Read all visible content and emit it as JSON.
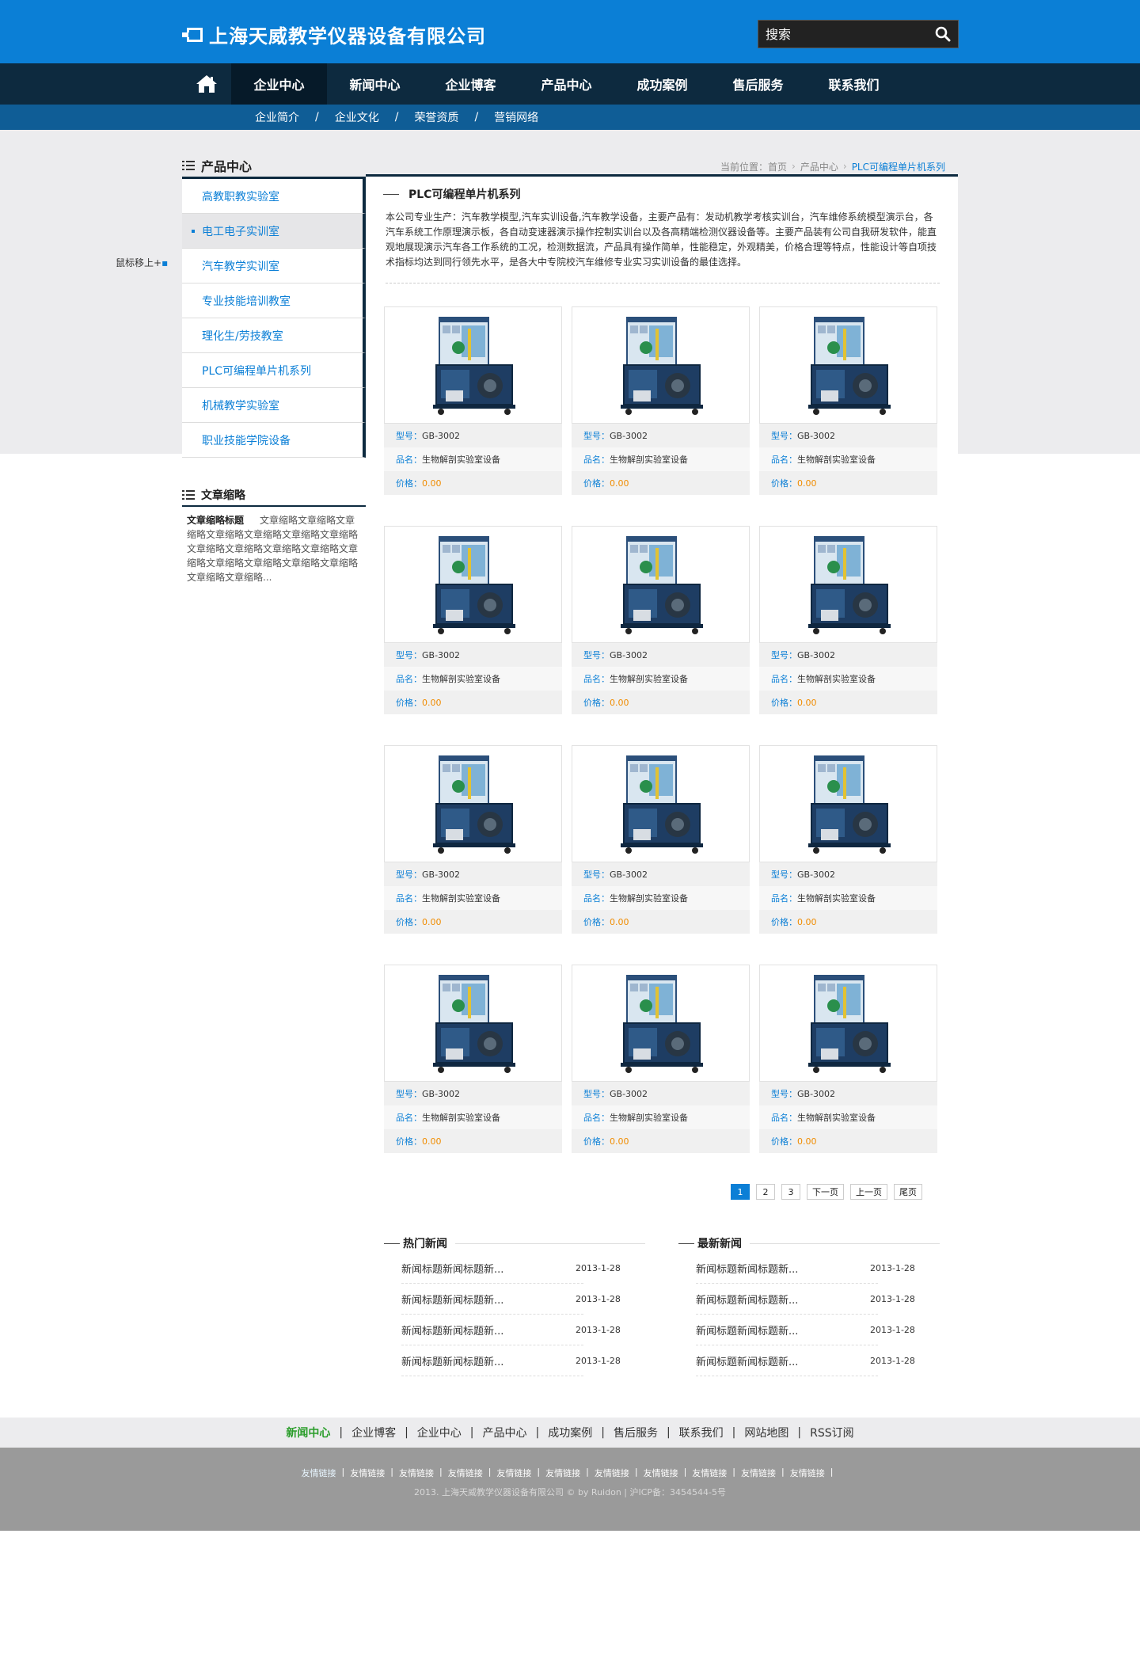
{
  "header": {
    "company_name": "上海天威教学仪器设备有限公司",
    "search_placeholder": "搜索"
  },
  "nav": {
    "items": [
      "企业中心",
      "新闻中心",
      "企业博客",
      "产品中心",
      "成功案例",
      "售后服务",
      "联系我们"
    ],
    "active": 0
  },
  "subnav": {
    "items": [
      "企业简介",
      "企业文化",
      "荣誉资质",
      "营销网络"
    ],
    "separator": "/"
  },
  "sidebar": {
    "title": "产品中心",
    "items": [
      "高教职教实验室",
      "电工电子实训室",
      "汽车教学实训室",
      "专业技能培训教室",
      "理化生/劳技教室",
      "PLC可编程单片机系列",
      "机械教学实验室",
      "职业技能学院设备"
    ],
    "active": 1,
    "hover_tip": "鼠标移上+"
  },
  "summary": {
    "title": "文章缩略",
    "heading": "文章缩略标题",
    "text": "文章缩略文章缩略文章缩略文章缩略文章缩略文章缩略文章缩略文章缩略文章缩略文章缩略文章缩略文章缩略文章缩略文章缩略文章缩略文章缩略文章缩略文章缩略..."
  },
  "breadcrumb": {
    "label": "当前位置：",
    "items": [
      "首页",
      "产品中心",
      "PLC可编程单片机系列"
    ]
  },
  "main": {
    "title": "PLC可编程单片机系列",
    "description": "本公司专业生产：汽车教学模型,汽车实训设备,汽车教学设备，主要产品有：发动机教学考核实训台，汽车维修系统模型演示台，各汽车系统工作原理演示板，各自动变速器演示操作控制实训台以及各高精端检测仪器设备等。主要产品装有公司自我研发软件，能直观地展现演示汽车各工作系统的工况，检测数据流，产品具有操作简单，性能稳定，外观精美，价格合理等特点，性能设计等自项技术指标均达到同行领先水平，是各大中专院校汽车维修专业实习实训设备的最佳选择。"
  },
  "products": {
    "labels": {
      "model": "型号：",
      "name": "品名：",
      "price": "价格："
    },
    "items": [
      {
        "model": "GB-3002",
        "name": "生物解剖实验室设备",
        "price": "0.00"
      },
      {
        "model": "GB-3002",
        "name": "生物解剖实验室设备",
        "price": "0.00"
      },
      {
        "model": "GB-3002",
        "name": "生物解剖实验室设备",
        "price": "0.00"
      },
      {
        "model": "GB-3002",
        "name": "生物解剖实验室设备",
        "price": "0.00"
      },
      {
        "model": "GB-3002",
        "name": "生物解剖实验室设备",
        "price": "0.00"
      },
      {
        "model": "GB-3002",
        "name": "生物解剖实验室设备",
        "price": "0.00"
      },
      {
        "model": "GB-3002",
        "name": "生物解剖实验室设备",
        "price": "0.00"
      },
      {
        "model": "GB-3002",
        "name": "生物解剖实验室设备",
        "price": "0.00"
      },
      {
        "model": "GB-3002",
        "name": "生物解剖实验室设备",
        "price": "0.00"
      },
      {
        "model": "GB-3002",
        "name": "生物解剖实验室设备",
        "price": "0.00"
      },
      {
        "model": "GB-3002",
        "name": "生物解剖实验室设备",
        "price": "0.00"
      },
      {
        "model": "GB-3002",
        "name": "生物解剖实验室设备",
        "price": "0.00"
      }
    ]
  },
  "pager": {
    "pages": [
      "1",
      "2",
      "3"
    ],
    "active": 0,
    "next": "下一页",
    "prev": "上一页",
    "last": "尾页"
  },
  "hot_news": {
    "title": "热门新闻",
    "items": [
      {
        "title": "新闻标题新闻标题新...",
        "date": "2013-1-28"
      },
      {
        "title": "新闻标题新闻标题新...",
        "date": "2013-1-28"
      },
      {
        "title": "新闻标题新闻标题新...",
        "date": "2013-1-28"
      },
      {
        "title": "新闻标题新闻标题新...",
        "date": "2013-1-28"
      }
    ]
  },
  "latest_news": {
    "title": "最新新闻",
    "items": [
      {
        "title": "新闻标题新闻标题新...",
        "date": "2013-1-28"
      },
      {
        "title": "新闻标题新闻标题新...",
        "date": "2013-1-28"
      },
      {
        "title": "新闻标题新闻标题新...",
        "date": "2013-1-28"
      },
      {
        "title": "新闻标题新闻标题新...",
        "date": "2013-1-28"
      }
    ]
  },
  "footer_nav": {
    "items": [
      "新闻中心",
      "企业博客",
      "企业中心",
      "产品中心",
      "成功案例",
      "售后服务",
      "联系我们",
      "网站地图",
      "RSS订阅"
    ],
    "active": 0
  },
  "footer": {
    "links": [
      "友情链接",
      "友情链接",
      "友情链接",
      "友情链接",
      "友情链接",
      "友情链接",
      "友情链接",
      "友情链接",
      "友情链接",
      "友情链接",
      "友情链接"
    ],
    "copyright": "2013. 上海天威教学仪器设备有限公司 © by Ruidon | 沪ICP备：3454544-5号"
  },
  "colors": {
    "brand_blue": "#0b7fd6",
    "nav_dark": "#0d2a3f",
    "subnav_blue": "#0f5d96",
    "price_orange": "#f08c00"
  }
}
